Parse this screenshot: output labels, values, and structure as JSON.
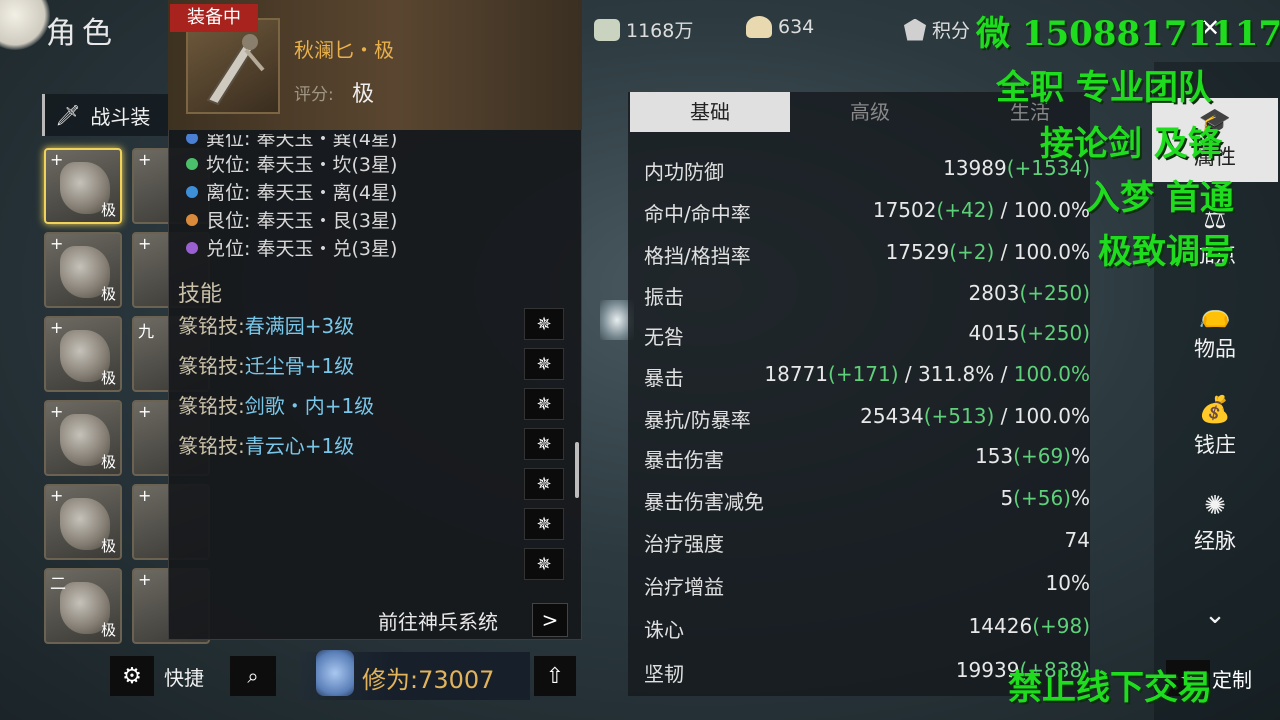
{
  "header": {
    "title": "角色"
  },
  "equipment": {
    "tab_label": "战斗装",
    "slots": [
      {
        "plus": "+",
        "grade": "极",
        "selected": true
      },
      {
        "plus": "+",
        "grade": "",
        "selected": false
      },
      {
        "plus": "+",
        "grade": "极",
        "selected": false
      },
      {
        "plus": "+",
        "grade": "",
        "selected": false
      },
      {
        "plus": "+",
        "grade": "极",
        "selected": false
      },
      {
        "plus": "九",
        "grade": "",
        "selected": false
      },
      {
        "plus": "+",
        "grade": "极",
        "selected": false
      },
      {
        "plus": "+",
        "grade": "",
        "selected": false
      },
      {
        "plus": "+",
        "grade": "极",
        "selected": false
      },
      {
        "plus": "+",
        "grade": "",
        "selected": false
      },
      {
        "plus": "二",
        "grade": "极",
        "selected": false
      },
      {
        "plus": "+",
        "grade": "",
        "selected": false
      }
    ]
  },
  "tooltip": {
    "badge": "装备中",
    "item_name": "秋澜匕・极",
    "score_label": "评分:",
    "score_value": "极",
    "gems": [
      {
        "text": "巽位: 奉天玉・巽(4星)",
        "color": "#4a7fd4"
      },
      {
        "text": "坎位: 奉天玉・坎(3星)",
        "color": "#4bbf6a"
      },
      {
        "text": "离位: 奉天玉・离(4星)",
        "color": "#3d8fd8"
      },
      {
        "text": "艮位: 奉天玉・艮(3星)",
        "color": "#d98a3a"
      },
      {
        "text": "兑位: 奉天玉・兑(3星)",
        "color": "#9a5fd0"
      }
    ],
    "skills_title": "技能",
    "skills": [
      {
        "type": "篆铭技:",
        "name": "春满园",
        "level": "+3级"
      },
      {
        "type": "篆铭技:",
        "name": "迁尘骨",
        "level": "+1级"
      },
      {
        "type": "篆铭技:",
        "name": "剑歌・内",
        "level": "+1级"
      },
      {
        "type": "篆铭技:",
        "name": "青云心",
        "level": "+1级"
      }
    ],
    "goto_label": "前往神兵系统",
    "goto_arrow": ">"
  },
  "bottom": {
    "gear_icon": "⚙",
    "quick_label": "快捷",
    "search_icon": "⌕",
    "cultivation_label": "修为:",
    "cultivation_value": "73007",
    "up_icon": "⇧"
  },
  "currency": [
    {
      "value": "1168万",
      "icon": "silver-icon",
      "color": "#c9d3c0"
    },
    {
      "value": "634",
      "icon": "ingot-icon",
      "color": "#e9d9b0"
    },
    {
      "value": "积分",
      "icon": "badge-icon",
      "color": "#d0d0d0"
    }
  ],
  "stats": {
    "tabs": [
      "基础",
      "高级",
      "生活"
    ],
    "active_tab": 0,
    "rows": [
      {
        "label": "内功防御",
        "base": "13989",
        "bonus": "(+1534)",
        "rest": "",
        "rest_green": ""
      },
      {
        "label": "命中/命中率",
        "base": "17502",
        "bonus": "(+42)",
        "rest": " / 100.0%",
        "rest_green": ""
      },
      {
        "label": "格挡/格挡率",
        "base": "17529",
        "bonus": "(+2)",
        "rest": " / 100.0%",
        "rest_green": ""
      },
      {
        "label": "振击",
        "base": "2803",
        "bonus": "(+250)",
        "rest": "",
        "rest_green": ""
      },
      {
        "label": "无咎",
        "base": "4015",
        "bonus": "(+250)",
        "rest": "",
        "rest_green": ""
      },
      {
        "label": "暴击",
        "base": "18771",
        "bonus": "(+171)",
        "rest": " / 311.8% / ",
        "rest_green": "100.0%"
      },
      {
        "label": "暴抗/防暴率",
        "base": "25434",
        "bonus": "(+513)",
        "rest": " / 100.0%",
        "rest_green": ""
      },
      {
        "label": "暴击伤害",
        "base": "153",
        "bonus": "(+69)",
        "rest": "%",
        "rest_green": ""
      },
      {
        "label": "暴击伤害减免",
        "base": "5",
        "bonus": "(+56)",
        "rest": "%",
        "rest_green": ""
      },
      {
        "label": "治疗强度",
        "base": "74",
        "bonus": "",
        "rest": "",
        "rest_green": ""
      },
      {
        "label": "治疗增益",
        "base": "10%",
        "bonus": "",
        "rest": "",
        "rest_green": ""
      },
      {
        "label": "诛心",
        "base": "14426",
        "bonus": "(+98)",
        "rest": "",
        "rest_green": ""
      },
      {
        "label": "坚韧",
        "base": "19939",
        "bonus": "(+838)",
        "rest": "",
        "rest_green": ""
      }
    ]
  },
  "nav": {
    "items": [
      {
        "label": "属性",
        "icon": "🎓",
        "active": true
      },
      {
        "label": "加点",
        "icon": "⚖",
        "active": false
      },
      {
        "label": "物品",
        "icon": "👝",
        "active": false
      },
      {
        "label": "钱庄",
        "icon": "💰",
        "active": false
      },
      {
        "label": "经脉",
        "icon": "✺",
        "active": false
      }
    ],
    "more_icon": "⌄",
    "custom_label": "定制",
    "custom_icon": "✧",
    "close_icon": "✕"
  },
  "overlay": {
    "line1": "微 15088171117",
    "line2": "全职 专业团队",
    "line3": "接论剑 及锋",
    "line4": "入梦 首通",
    "line5": "极致调号",
    "line6": "禁止线下交易"
  }
}
